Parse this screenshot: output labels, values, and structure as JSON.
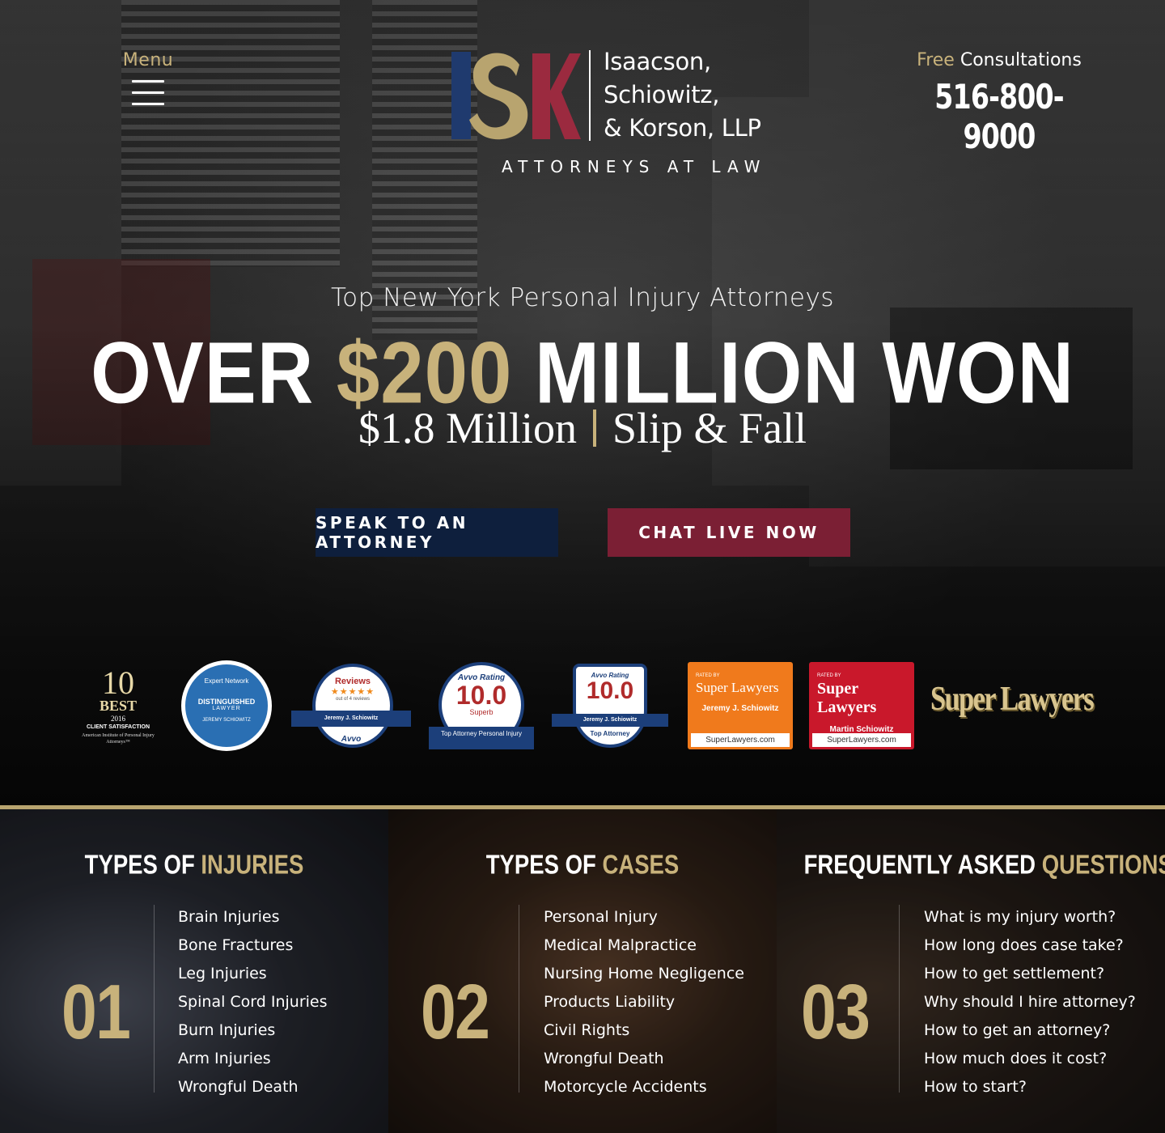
{
  "header": {
    "menu_label": "Menu",
    "firm_name_line1": "Isaacson,",
    "firm_name_line2": "Schiowitz,",
    "firm_name_line3": "& Korson, LLP",
    "tagline": "ATTORNEYS AT LAW",
    "logo_letters": "ISK",
    "consult_free": "Free",
    "consult_rest": "Consultations",
    "phone": "516-800-9000"
  },
  "hero": {
    "subtitle": "Top New York Personal Injury Attorneys",
    "headline_pre": "OVER",
    "headline_gold": "$200",
    "headline_post": "MILLION WON",
    "result_amount": "$1.8 Million",
    "result_type": "Slip & Fall",
    "btn_speak": "SPEAK TO AN ATTORNEY",
    "btn_chat": "CHAT LIVE NOW"
  },
  "badges": {
    "aipia": {
      "number": "10",
      "best": "BEST",
      "year": "2016",
      "label": "CLIENT SATISFACTION",
      "org": "American Institute of Personal Injury Attorneys™"
    },
    "expert_network": {
      "top": "Expert Network",
      "title": "DISTINGUISHED",
      "sub": "LAWYER",
      "name": "JEREMY SCHIOWITZ"
    },
    "avvo_reviews": {
      "title": "Reviews",
      "stars": "★★★★★",
      "count": "out of 4 reviews",
      "name": "Jeremy J. Schiowitz",
      "brand": "Avvo"
    },
    "avvo_rating": {
      "label": "Avvo Rating",
      "value": "10.0",
      "grade": "Superb",
      "ribbon": "Top Attorney Personal Injury"
    },
    "avvo_top": {
      "label": "Avvo Rating",
      "value": "10.0",
      "name": "Jeremy J. Schiowitz",
      "ribbon": "Top Attorney"
    },
    "super_lawyers_1": {
      "rated": "RATED BY",
      "title": "Super Lawyers",
      "name": "Jeremy J. Schiowitz",
      "site": "SuperLawyers.com"
    },
    "super_lawyers_2": {
      "rated": "RATED BY",
      "title": "Super Lawyers",
      "name": "Martin Schiowitz",
      "site": "SuperLawyers.com"
    },
    "super_lawyers_logo": "Super Lawyers"
  },
  "cards": [
    {
      "title_pre": "TYPES OF",
      "title_gold": "INJURIES",
      "number": "01",
      "items": [
        "Brain Injuries",
        "Bone Fractures",
        "Leg Injuries",
        "Spinal Cord Injuries",
        "Burn Injuries",
        "Arm Injuries",
        "Wrongful Death"
      ]
    },
    {
      "title_pre": "TYPES OF",
      "title_gold": "CASES",
      "number": "02",
      "items": [
        "Personal Injury",
        "Medical Malpractice",
        "Nursing Home Negligence",
        "Products Liability",
        "Civil Rights",
        "Wrongful Death",
        "Motorcycle Accidents"
      ]
    },
    {
      "title_pre": "FREQUENTLY ASKED",
      "title_gold": "QUESTIONS",
      "number": "03",
      "items": [
        "What is my injury worth?",
        "How long does case take?",
        "How to get settlement?",
        "Why should I hire attorney?",
        "How to get an attorney?",
        "How much does it cost?",
        "How to start?"
      ]
    }
  ],
  "colors": {
    "gold": "#c8b27b",
    "navy": "#0e1f3d",
    "maroon": "#7b1f34",
    "logo_blue": "#1f3a6e",
    "logo_red": "#9b2a3f"
  }
}
